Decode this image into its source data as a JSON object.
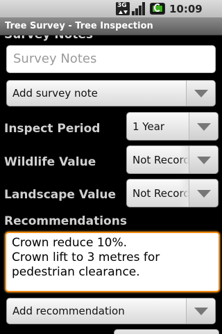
{
  "status_bar": {
    "network": "3G",
    "time": "10:09 AM"
  },
  "title_bar": {
    "title": "Tree Survey - Tree Inspection"
  },
  "survey_notes": {
    "label": "Survey Notes",
    "placeholder": "Survey Notes",
    "add_note_spinner": "Add survey note"
  },
  "inspect_period": {
    "label": "Inspect Period",
    "value": "1 Year"
  },
  "wildlife_value": {
    "label": "Wildlife Value",
    "value": "Not Recorded"
  },
  "landscape_value": {
    "label": "Landscape Value",
    "value": "Not Recorded"
  },
  "recommendations": {
    "label": "Recommendations",
    "text": "Crown reduce 10%.\nCrown lift to 3 metres for pedestrian clearance.",
    "add_spinner": "Add recommendation"
  }
}
